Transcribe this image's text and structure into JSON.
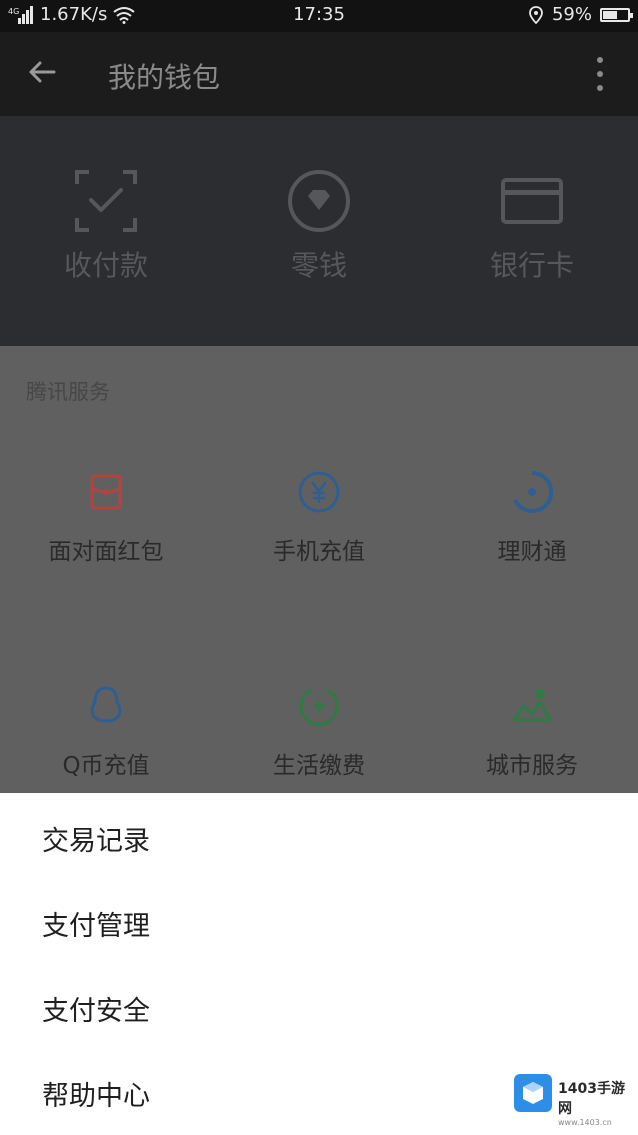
{
  "status_bar": {
    "network": "4G",
    "speed": "1.67K/s",
    "time": "17:35",
    "battery": "59%",
    "battery_level": 0.59
  },
  "app_bar": {
    "title": "我的钱包"
  },
  "wallet": {
    "items": [
      {
        "label": "收付款",
        "icon": "scan-pay-icon"
      },
      {
        "label": "零钱",
        "icon": "diamond-coin-icon"
      },
      {
        "label": "银行卡",
        "icon": "bank-card-icon"
      }
    ]
  },
  "tencent_services": {
    "title": "腾讯服务",
    "items": [
      {
        "label": "面对面红包",
        "icon": "red-packet-icon",
        "color": "#c1413e"
      },
      {
        "label": "手机充值",
        "icon": "yuan-circle-icon",
        "color": "#2f6fb1"
      },
      {
        "label": "理财通",
        "icon": "finance-icon",
        "color": "#2f6fb1"
      },
      {
        "label": "Q币充值",
        "icon": "penguin-icon",
        "color": "#2f6fb1"
      },
      {
        "label": "生活缴费",
        "icon": "lightning-icon",
        "color": "#2f8a4a"
      },
      {
        "label": "城市服务",
        "icon": "city-icon",
        "color": "#2f8a4a"
      }
    ]
  },
  "bottom_sheet": {
    "items": [
      "交易记录",
      "支付管理",
      "支付安全",
      "帮助中心"
    ]
  },
  "watermark": {
    "text": "1403手游网",
    "sub": "www.1403.cn"
  }
}
